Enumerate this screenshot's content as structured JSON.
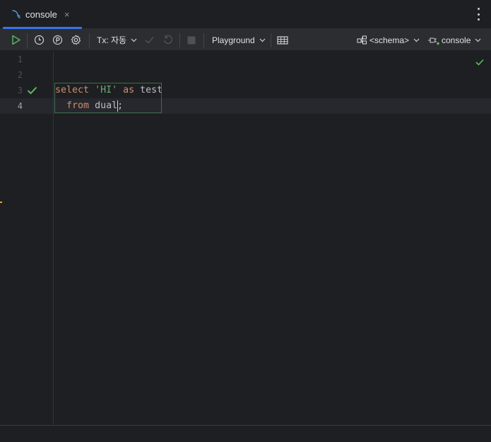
{
  "tab": {
    "label": "console",
    "close_glyph": "×"
  },
  "toolbar": {
    "tx_label": "Tx: 자동",
    "playground_label": "Playground",
    "schema_label": "<schema>",
    "console_label": "console"
  },
  "editor": {
    "line_numbers": [
      "1",
      "2",
      "3",
      "4"
    ],
    "lines": {
      "l3": {
        "kw1": "select",
        "str1": "'HI'",
        "kw2": "as",
        "ident": "test"
      },
      "l4": {
        "indent": "  ",
        "kw1": "from",
        "ident": "dual",
        "punct": ";"
      }
    }
  },
  "colors": {
    "accent": "#3574f0",
    "keyword": "#cf8e6d",
    "string": "#6aab73",
    "success": "#5fb865"
  }
}
